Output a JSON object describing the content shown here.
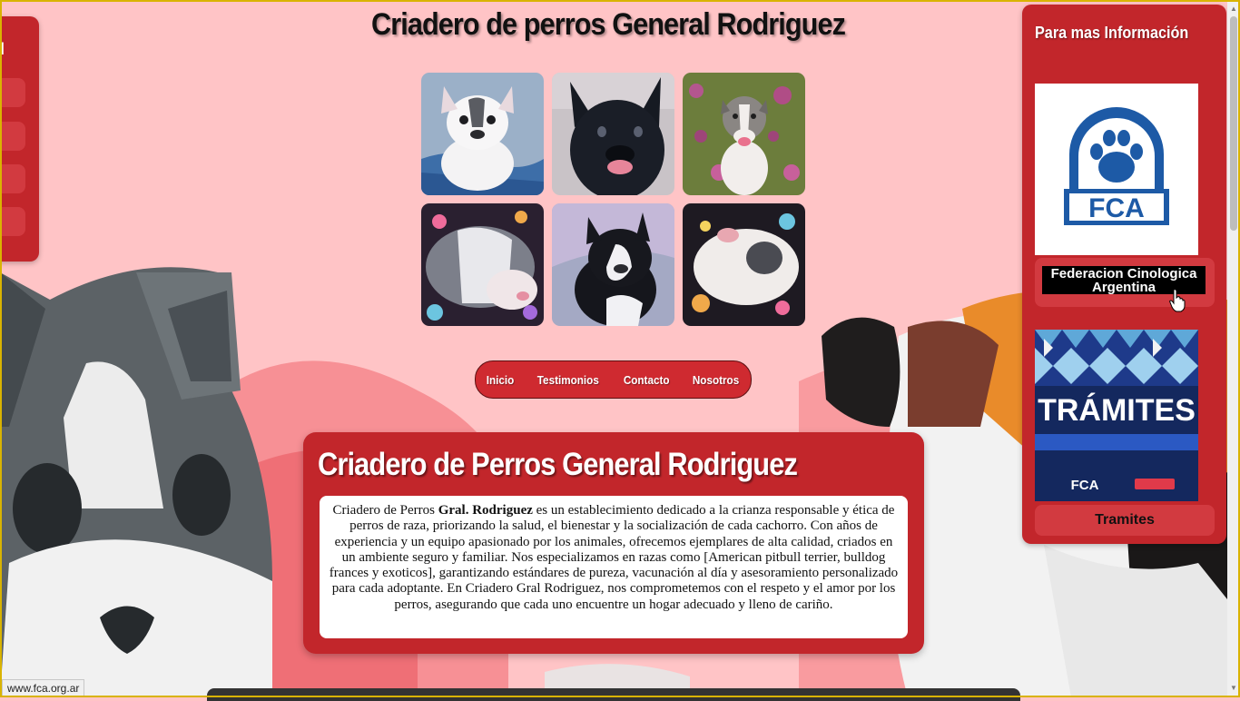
{
  "header": {
    "title": "Criadero de perros General Rodriguez"
  },
  "gallery": [
    {
      "name": "puppy-photo-1"
    },
    {
      "name": "puppy-photo-2"
    },
    {
      "name": "puppy-photo-3"
    },
    {
      "name": "puppy-photo-4"
    },
    {
      "name": "puppy-photo-5"
    },
    {
      "name": "puppy-photo-6"
    }
  ],
  "nav": {
    "items": [
      "Inicio",
      "Testimonios",
      "Contacto",
      "Nosotros"
    ]
  },
  "about": {
    "heading": "Criadero de Perros General Rodriguez",
    "text_before": "Criadero de Perros ",
    "text_bold": "Gral. Rodriguez",
    "text_after": " es un establecimiento dedicado a la crianza responsable y ética de perros de raza, priorizando la salud, el bienestar y la socialización de cada cachorro. Con años de experiencia y un equipo apasionado por los animales, ofrecemos ejemplares de alta calidad, criados en un ambiente seguro y familiar. Nos especializamos en razas como [American pitbull terrier, bulldog frances y exoticos], garantizando estándares de pureza, vacunación al día y asesoramiento personalizado para cada adoptante. En Criadero Gral Rodriguez, nos comprometemos con el respeto y el amor por los perros, asegurando que cada uno encuentre un hogar adecuado y lleno de cariño."
  },
  "left_panel": {
    "visible_text": "l"
  },
  "right_panel": {
    "title": "Para mas Información",
    "fca_logo_text": "FCA",
    "fca_link": "Federacion Cinologica Argentina",
    "tramites_banner_text": "TRÁMITES",
    "tramites_banner_footer": "FCA",
    "tramites_link": "Tramites"
  },
  "status_bar": {
    "url": "www.fca.org.ar"
  },
  "colors": {
    "page_bg": "#ffc4c6",
    "panel_red": "#c2262b",
    "nav_red": "#cf2a30",
    "fca_blue": "#1d5aa6"
  }
}
